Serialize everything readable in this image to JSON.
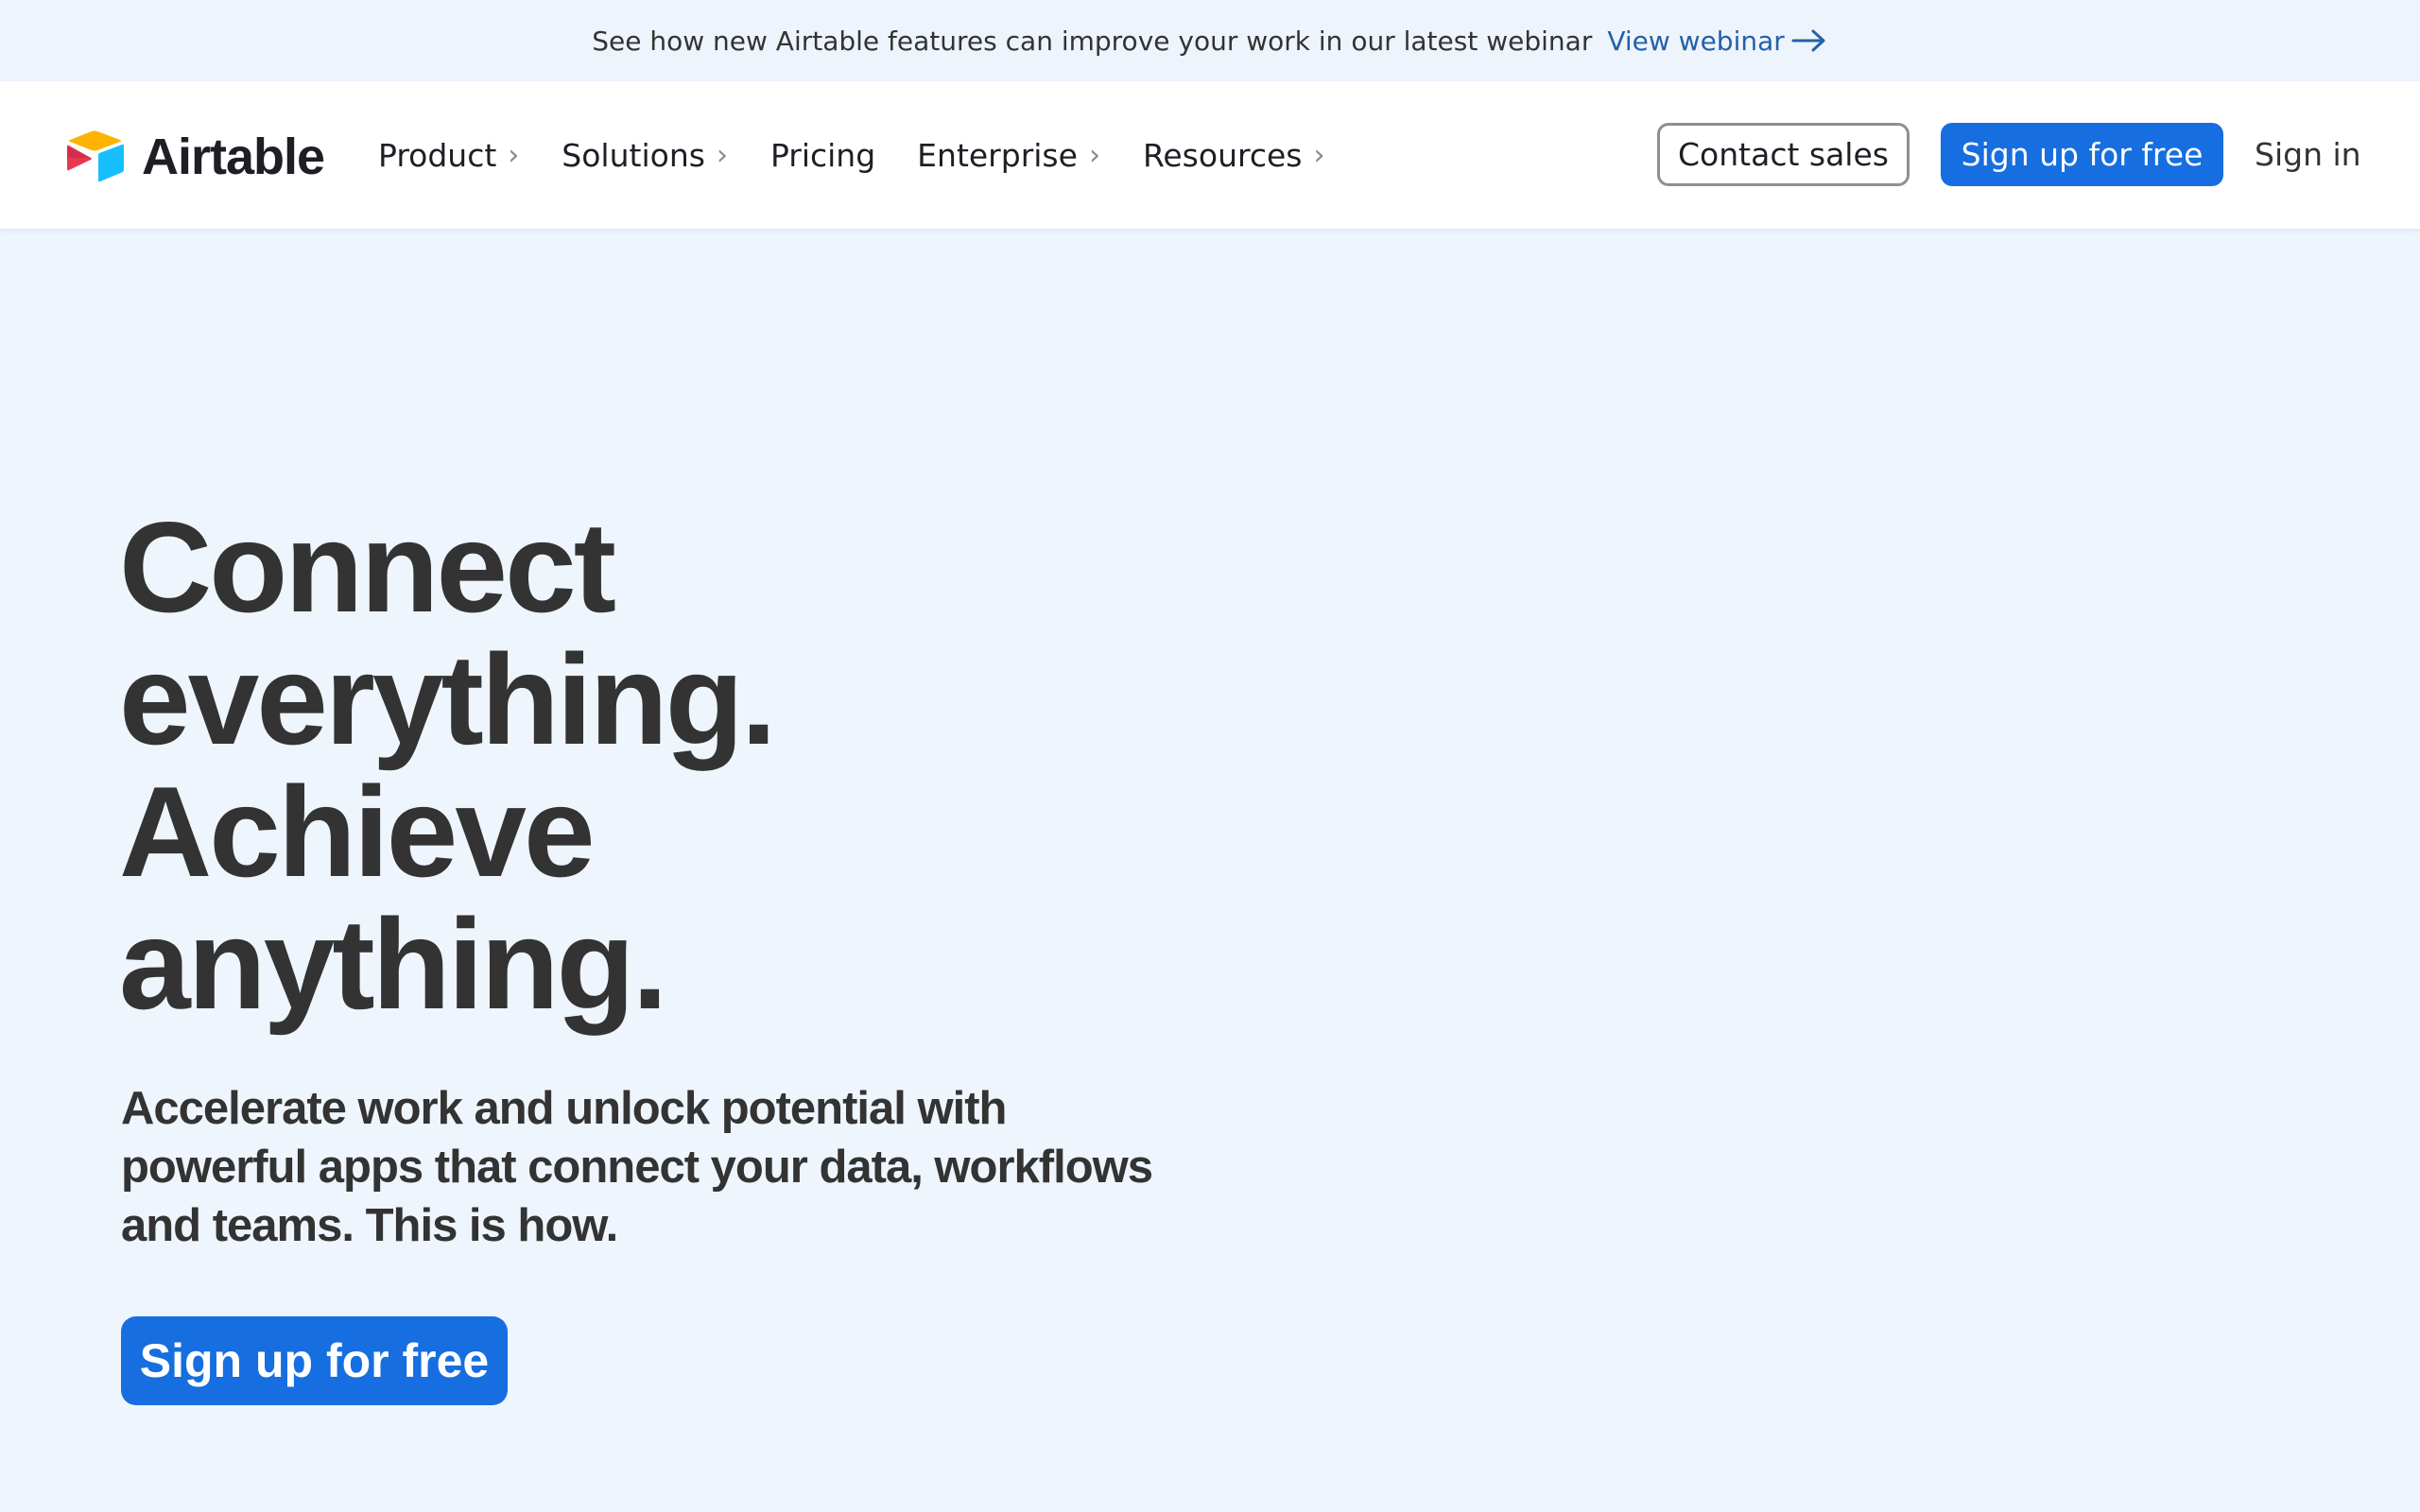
{
  "banner": {
    "message": "See how new Airtable features can improve your work in our latest webinar",
    "link_label": "View webinar",
    "link_icon": "arrow-right-icon"
  },
  "header": {
    "logo": {
      "wordmark": "Airtable",
      "icon": "airtable-logo-icon"
    },
    "nav": [
      {
        "label": "Product",
        "has_submenu": true,
        "icon": "chevron-right-icon"
      },
      {
        "label": "Solutions",
        "has_submenu": true,
        "icon": "chevron-right-icon"
      },
      {
        "label": "Pricing",
        "has_submenu": false
      },
      {
        "label": "Enterprise",
        "has_submenu": true,
        "icon": "chevron-right-icon"
      },
      {
        "label": "Resources",
        "has_submenu": true,
        "icon": "chevron-right-icon"
      }
    ],
    "chevron_glyph": "›",
    "contact_sales_label": "Contact sales",
    "signup_label": "Sign up for free",
    "signin_label": "Sign in"
  },
  "hero": {
    "title_lines": [
      "Connect",
      "everything.",
      "Achieve",
      "anything."
    ],
    "subtitle_lines": [
      "Accelerate work and unlock potential with",
      "powerful apps that connect your data, workflows",
      "and teams. This is how."
    ],
    "cta_label": "Sign up for free"
  },
  "colors": {
    "accent_blue": "#166ee1",
    "link_blue": "#2461a8",
    "page_background": "#eef5fd",
    "text_dark": "#333333",
    "logo_yellow": "#fcb400",
    "logo_red": "#e8384f",
    "logo_cyan": "#18bfff"
  }
}
